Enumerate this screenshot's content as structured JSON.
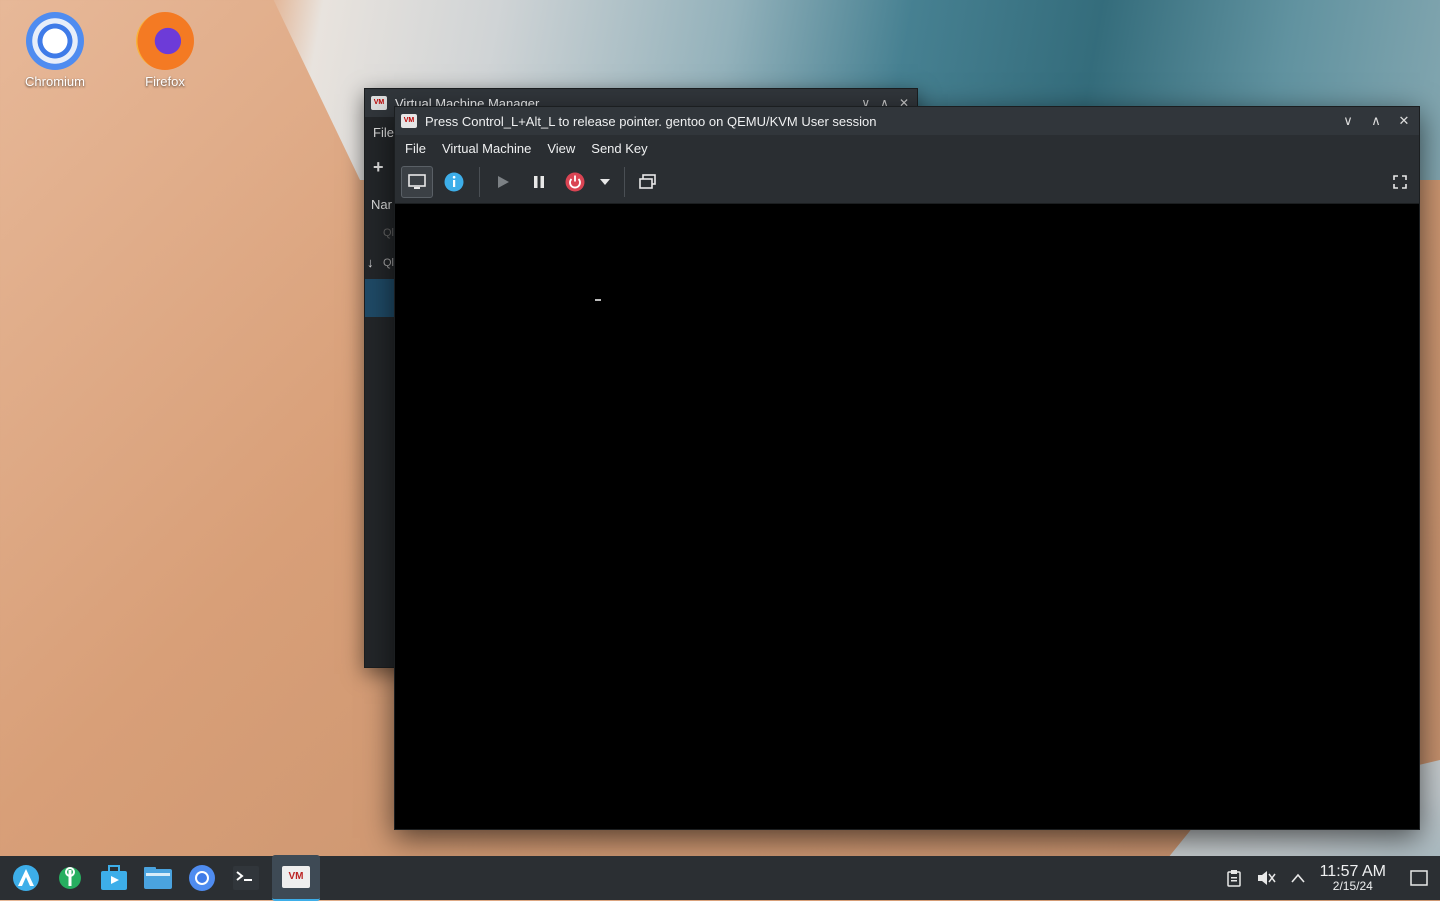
{
  "desktop": {
    "icons": [
      {
        "label": "Chromium",
        "icon": "chromium-icon"
      },
      {
        "label": "Firefox",
        "icon": "firefox-icon"
      }
    ]
  },
  "back_window": {
    "title": "Virtual Machine Manager",
    "menu_partial": "File",
    "column_partial": "Nar",
    "row_partial_1": "Ql",
    "row_partial_2": "Ql"
  },
  "viewer_window": {
    "title": "Press Control_L+Alt_L to release pointer. gentoo on QEMU/KVM User session",
    "menu": [
      "File",
      "Virtual Machine",
      "View",
      "Send Key"
    ],
    "toolbar": {
      "console_icon": "monitor-icon",
      "details_icon": "info-icon",
      "run_icon": "play-icon",
      "pause_icon": "pause-icon",
      "shutdown_icon": "power-icon",
      "shutdown_menu_icon": "chevron-down-icon",
      "snapshots_icon": "windows-icon",
      "fullscreen_icon": "fullscreen-icon"
    }
  },
  "taskbar": {
    "time": "11:57 AM",
    "date": "2/15/24"
  }
}
